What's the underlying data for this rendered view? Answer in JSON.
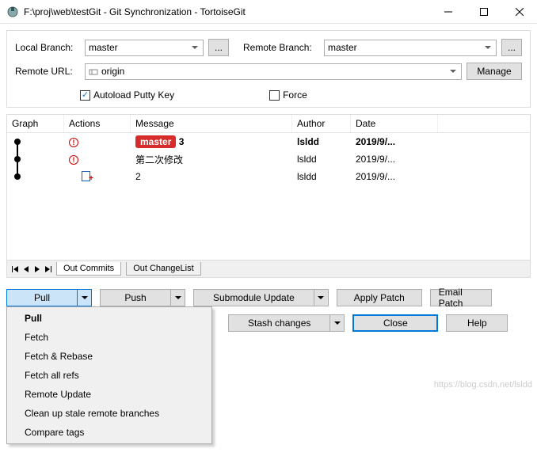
{
  "window": {
    "title": "F:\\proj\\web\\testGit - Git Synchronization - TortoiseGit"
  },
  "form": {
    "local_branch_label": "Local Branch:",
    "local_branch_value": "master",
    "remote_branch_label": "Remote Branch:",
    "remote_branch_value": "master",
    "remote_url_label": "Remote URL:",
    "remote_url_value": "origin",
    "manage_label": "Manage",
    "browse_label": "...",
    "autoload_label": "Autoload Putty Key",
    "autoload_checked": true,
    "force_label": "Force",
    "force_checked": false
  },
  "grid": {
    "headers": {
      "graph": "Graph",
      "actions": "Actions",
      "message": "Message",
      "author": "Author",
      "date": "Date"
    },
    "rows": [
      {
        "badge": "master",
        "message": "3",
        "author": "lsldd",
        "date": "2019/9/...",
        "bold": true
      },
      {
        "message": "第二次修改",
        "author": "lsldd",
        "date": "2019/9/..."
      },
      {
        "message": "2",
        "author": "lsldd",
        "date": "2019/9/..."
      }
    ]
  },
  "tabs": {
    "out_commits": "Out Commits",
    "out_changelist": "Out ChangeList"
  },
  "buttons": {
    "pull": "Pull",
    "push": "Push",
    "submodule": "Submodule Update",
    "apply_patch": "Apply Patch",
    "email_patch": "Email Patch",
    "stash": "Stash changes",
    "close": "Close",
    "help": "Help"
  },
  "menu": {
    "items": [
      "Pull",
      "Fetch",
      "Fetch & Rebase",
      "Fetch all refs",
      "Remote Update",
      "Clean up stale remote branches",
      "Compare tags"
    ]
  },
  "watermark": "https://blog.csdn.net/lsldd"
}
